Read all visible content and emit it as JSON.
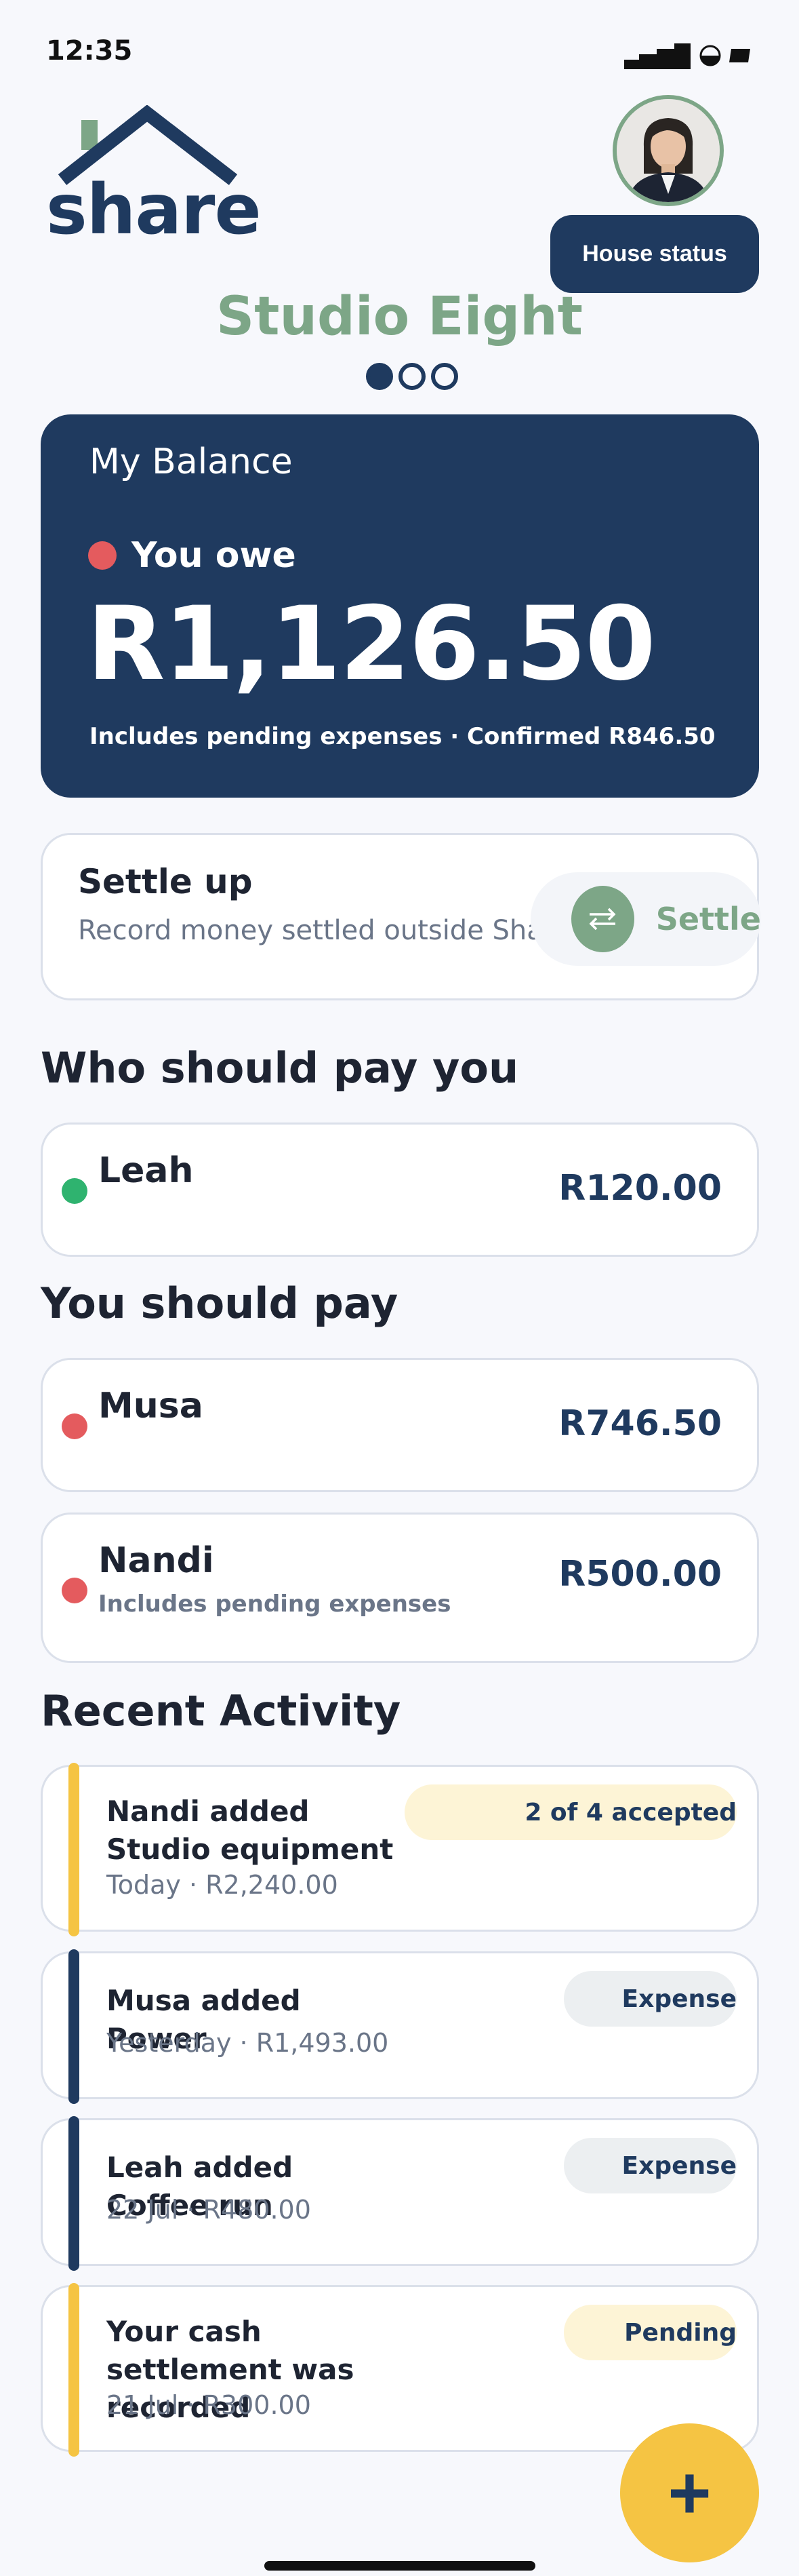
{
  "status_bar": {
    "time": "12:35"
  },
  "header": {
    "logo_text": "share",
    "house_status_label": "House status",
    "house_name": "Studio Eight"
  },
  "balance": {
    "title": "My Balance",
    "owe_label": "You owe",
    "amount": "R1,126.50",
    "note": "Includes pending expenses · Confirmed R846.50"
  },
  "settle": {
    "title": "Settle up",
    "subtitle": "Record money settled outside Share.",
    "button_label": "Settle"
  },
  "pay_you": {
    "title": "Who should pay you",
    "items": [
      {
        "name": "Leah",
        "amount": "R120.00"
      }
    ]
  },
  "you_pay": {
    "title": "You should pay",
    "items": [
      {
        "name": "Musa",
        "amount": "R746.50"
      },
      {
        "name": "Nandi",
        "note": "Includes pending expenses",
        "amount": "R500.00"
      }
    ]
  },
  "activity": {
    "title": "Recent Activity",
    "items": [
      {
        "title": "Nandi added Studio equipment",
        "meta": "Today · R2,240.00",
        "badge": "2 of 4 accepted"
      },
      {
        "title": "Musa added Power",
        "meta": "Yesterday · R1,493.00",
        "badge": "Expense"
      },
      {
        "title": "Leah added Coffee run",
        "meta": "22 Jul · R480.00",
        "badge": "Expense"
      },
      {
        "title": "Your cash settlement was recorded",
        "meta": "21 Jul · R300.00",
        "badge": "Pending"
      }
    ]
  },
  "fab_label": "+",
  "colors": {
    "navy": "#1f3a5f",
    "sage": "#7da687",
    "red": "#e45b5e",
    "green": "#2fb36f",
    "yellow": "#f5c443"
  }
}
